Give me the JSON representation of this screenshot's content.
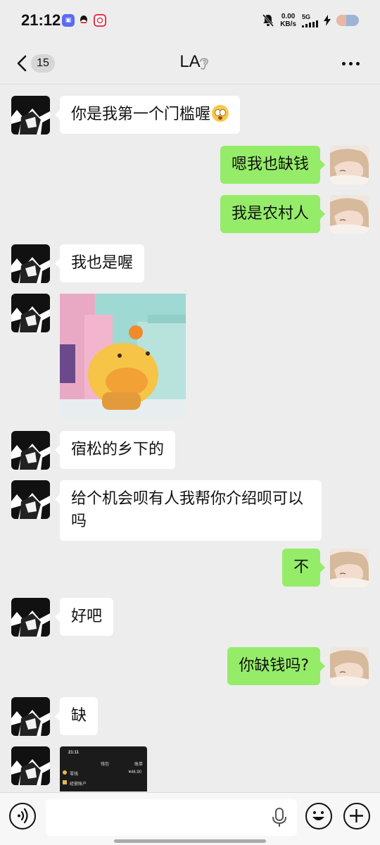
{
  "status_bar": {
    "time": "21:12",
    "net_speed_value": "0.00",
    "net_speed_unit": "KB/s",
    "network": "5G",
    "app_icons": [
      "app-badge-icon",
      "qq-icon",
      "app-red-icon"
    ]
  },
  "header": {
    "unread_count": "15",
    "title": "LA"
  },
  "messages": [
    {
      "side": "in",
      "text": "你是我第一个门槛喔",
      "emoji": "flushed-face"
    },
    {
      "side": "out",
      "text": "嗯我也缺钱"
    },
    {
      "side": "out",
      "text": "我是农村人"
    },
    {
      "side": "in",
      "text": "我也是喔"
    },
    {
      "side": "in",
      "type": "sticker",
      "sticker": "capybara-sticker"
    },
    {
      "side": "in",
      "text": "宿松的乡下的"
    },
    {
      "side": "in",
      "text": "给个机会呗有人我帮你介绍呗可以吗"
    },
    {
      "side": "out",
      "text": "不"
    },
    {
      "side": "in",
      "text": "好吧"
    },
    {
      "side": "out",
      "text": "你缺钱吗?"
    },
    {
      "side": "in",
      "text": "缺"
    },
    {
      "side": "in",
      "type": "image",
      "image": "wallet-screenshot"
    }
  ],
  "wallet_thumb": {
    "time": "21:11",
    "title": "钱包",
    "bill": "账单",
    "change_label": "零钱",
    "change_value": "¥46.90",
    "account_label": "经营账户"
  },
  "colors": {
    "background": "#ededed",
    "outgoing_bubble": "#95ec69",
    "incoming_bubble": "#ffffff"
  }
}
